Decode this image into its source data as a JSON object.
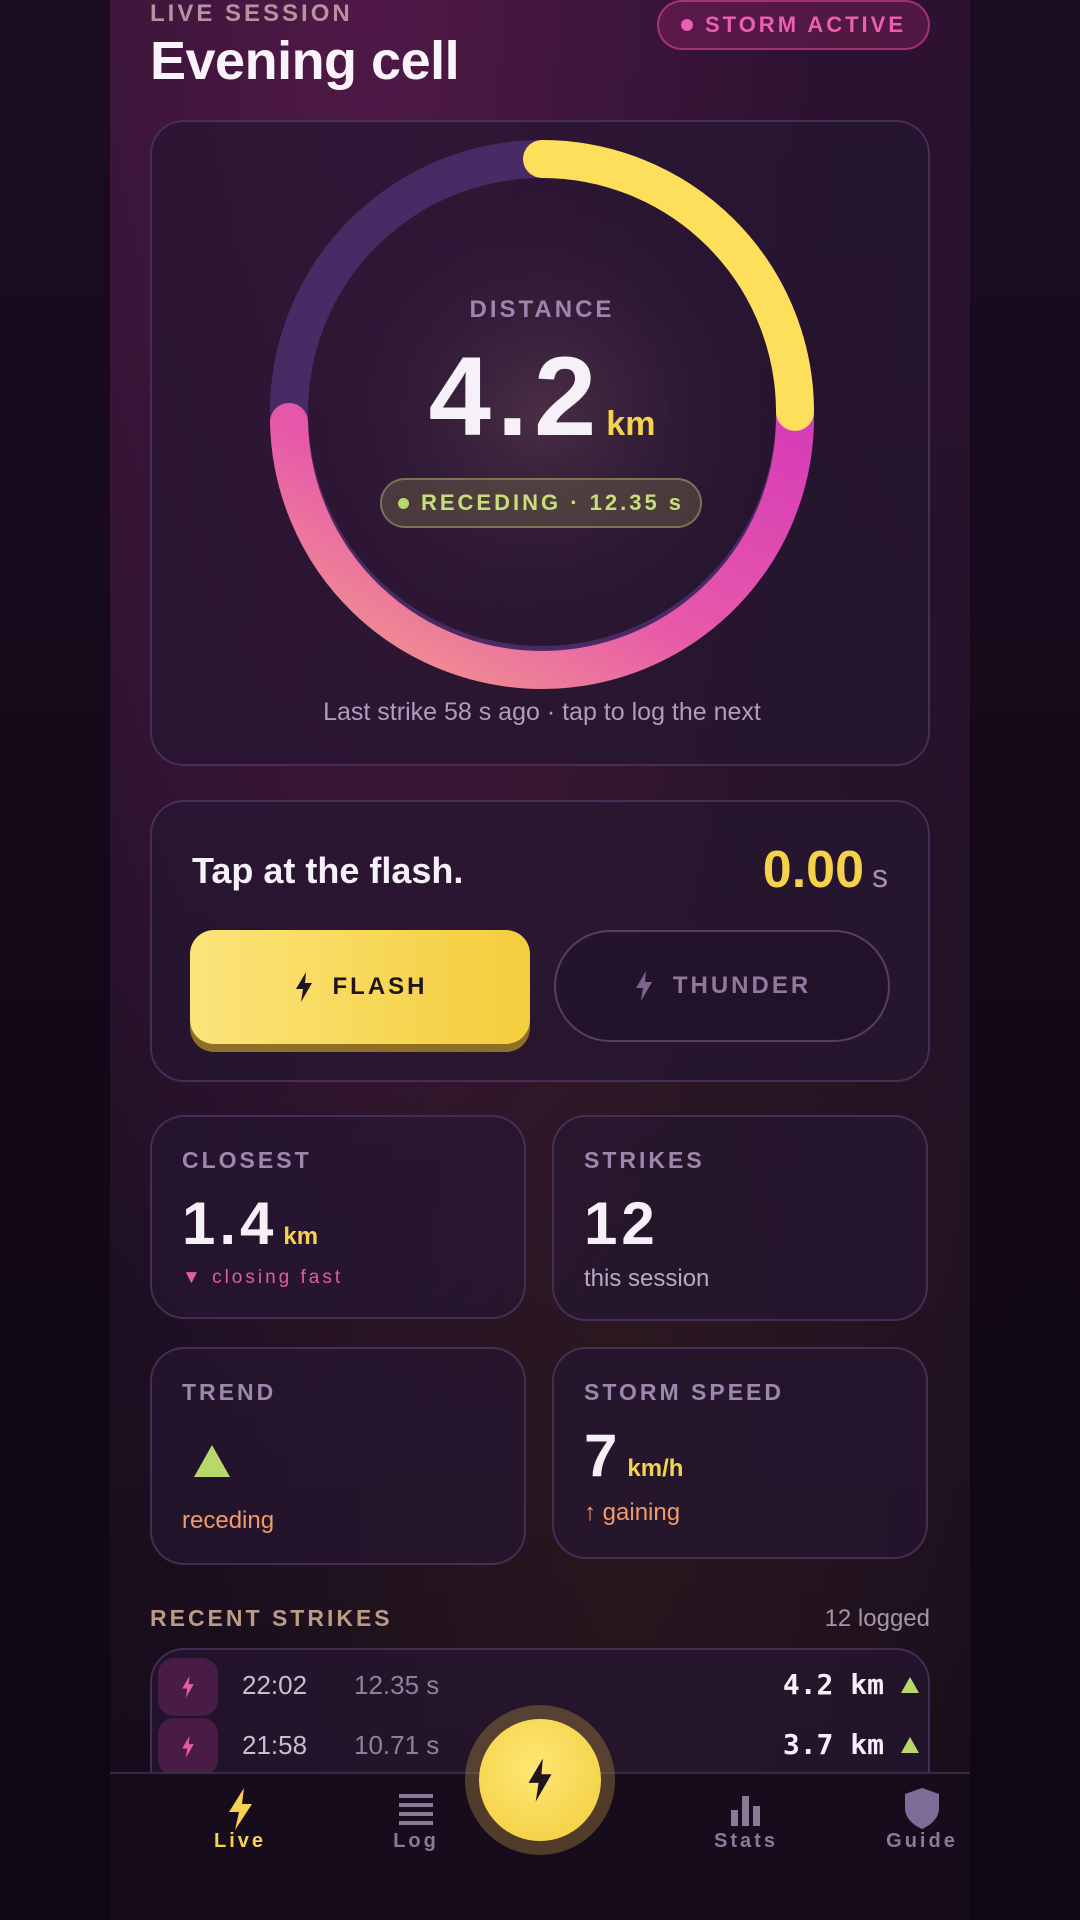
{
  "header": {
    "eyebrow": "LIVE SESSION",
    "title": "Evening cell",
    "status_pill": "STORM ACTIVE"
  },
  "gauge": {
    "label": "DISTANCE",
    "value": "4.2",
    "unit": "km",
    "status": "RECEDING · 12.35 s",
    "footer": "Last strike 58 s ago · tap to log the next"
  },
  "timer": {
    "prompt": "Tap at the flash.",
    "value": "0.00",
    "unit": "s",
    "flash_label": "FLASH",
    "thunder_label": "THUNDER"
  },
  "stats": {
    "closest": {
      "label": "CLOSEST",
      "value": "1.4",
      "unit": "km",
      "sub": "▼ closing fast"
    },
    "strikes": {
      "label": "STRIKES",
      "value": "12",
      "sub": "this session"
    },
    "trend": {
      "label": "TREND",
      "sub": "receding"
    },
    "speed": {
      "label": "STORM SPEED",
      "value": "7",
      "unit": "km/h",
      "sub": "↑ gaining"
    }
  },
  "recent": {
    "title": "RECENT STRIKES",
    "count": "12 logged",
    "rows": [
      {
        "time": "22:02",
        "delay": "12.35 s",
        "distance": "4.2 km"
      },
      {
        "time": "21:58",
        "delay": "10.71 s",
        "distance": "3.7 km"
      }
    ]
  },
  "nav": {
    "items": [
      {
        "label": "Live",
        "icon": "bolt-icon"
      },
      {
        "label": "Log",
        "icon": "list-icon"
      },
      {
        "label": "Stats",
        "icon": "bar-chart-icon"
      },
      {
        "label": "Guide",
        "icon": "shield-icon"
      }
    ],
    "fab_icon": "bolt-icon"
  },
  "colors": {
    "accent_yellow": "#f5d34f",
    "accent_pink": "#e04eb0",
    "positive_green": "#b8d86a",
    "warning_orange": "#f29a6a"
  }
}
